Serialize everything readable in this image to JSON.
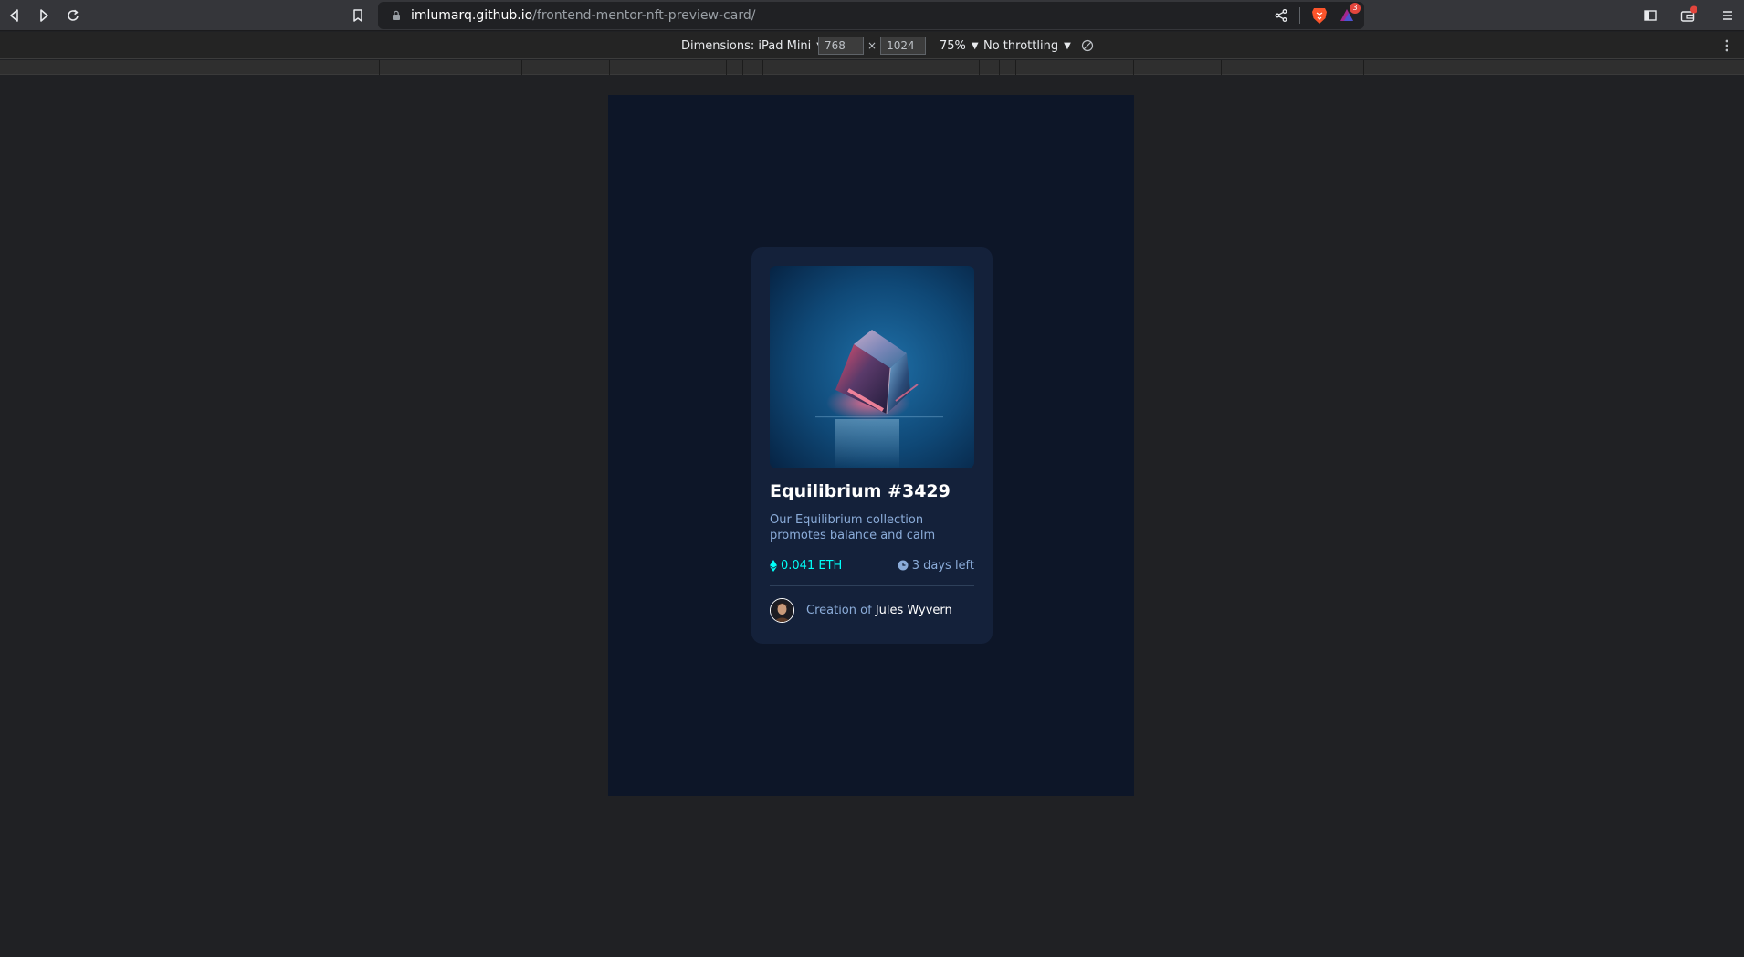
{
  "browser": {
    "url_host": "imlumarq.github.io",
    "url_path": "/frontend-mentor-nft-preview-card/",
    "shields_badge": "3"
  },
  "device_toolbar": {
    "dimensions_label": "Dimensions: iPad Mini",
    "width_value": "768",
    "times": "×",
    "height_value": "1024",
    "zoom": "75%",
    "throttling": "No throttling"
  },
  "card": {
    "title": "Equilibrium #3429",
    "description": "Our Equilibrium collection promotes balance and calm",
    "price": "0.041 ETH",
    "time_left": "3 days left",
    "creation_prefix": "Creation of ",
    "creator_name": "Jules Wyvern"
  },
  "colors": {
    "page_bg": "#0d1628",
    "card_bg": "#14213a",
    "accent_cyan": "#00fff8",
    "soft_blue": "#8bacd9",
    "white": "#ffffff"
  },
  "icons": {
    "back": "back-arrow-icon",
    "forward": "forward-arrow-icon",
    "reload": "reload-icon",
    "bookmark": "bookmark-icon",
    "lock": "lock-icon",
    "share": "share-icon",
    "brave": "brave-lion-icon",
    "rewards": "brave-rewards-icon",
    "sidebar": "sidebar-toggle-icon",
    "wallet": "wallet-icon",
    "menu": "menu-icon",
    "rotate": "rotate-icon",
    "devtools_more": "more-vertical-icon",
    "ethereum": "ethereum-icon",
    "clock": "clock-icon"
  }
}
